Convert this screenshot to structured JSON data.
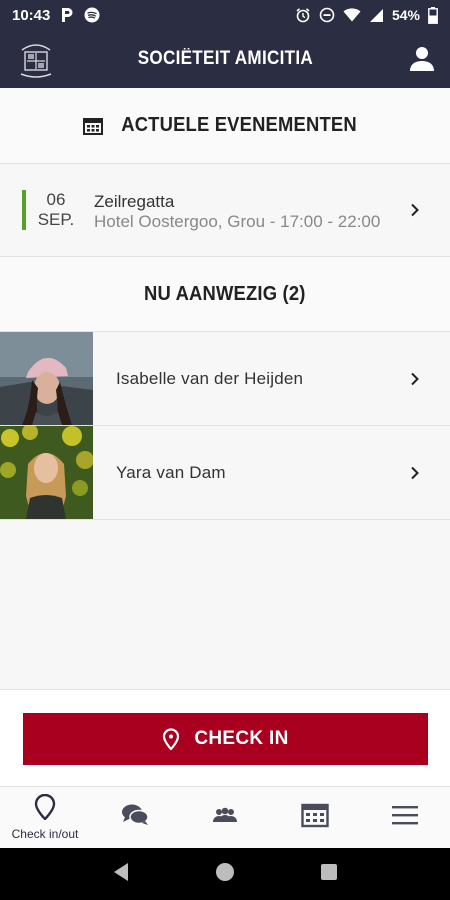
{
  "status_bar": {
    "time": "10:43",
    "battery": "54%"
  },
  "app_bar": {
    "title": "SOCIËTEIT AMICITIA"
  },
  "events": {
    "header": "ACTUELE EVENEMENTEN",
    "items": [
      {
        "day": "06",
        "month": "SEP.",
        "title": "Zeilregatta",
        "subtitle": "Hotel Oostergoo, Grou - 17:00 - 22:00",
        "accent": "#5aa02c"
      }
    ]
  },
  "present": {
    "header": "NU AANWEZIG (2)",
    "people": [
      {
        "name": "Isabelle van der Heijden"
      },
      {
        "name": "Yara van Dam"
      }
    ]
  },
  "checkin": {
    "label": "CHECK IN",
    "color": "#a8001e"
  },
  "tabs": [
    {
      "label": "Check in/out",
      "icon": "location-pin-icon",
      "active": true
    },
    {
      "label": "",
      "icon": "chat-icon"
    },
    {
      "label": "",
      "icon": "members-icon"
    },
    {
      "label": "",
      "icon": "calendar-icon"
    },
    {
      "label": "",
      "icon": "menu-icon"
    }
  ],
  "colors": {
    "primary": "#2b2d42",
    "accent_red": "#a8001e",
    "event_green": "#5aa02c"
  }
}
